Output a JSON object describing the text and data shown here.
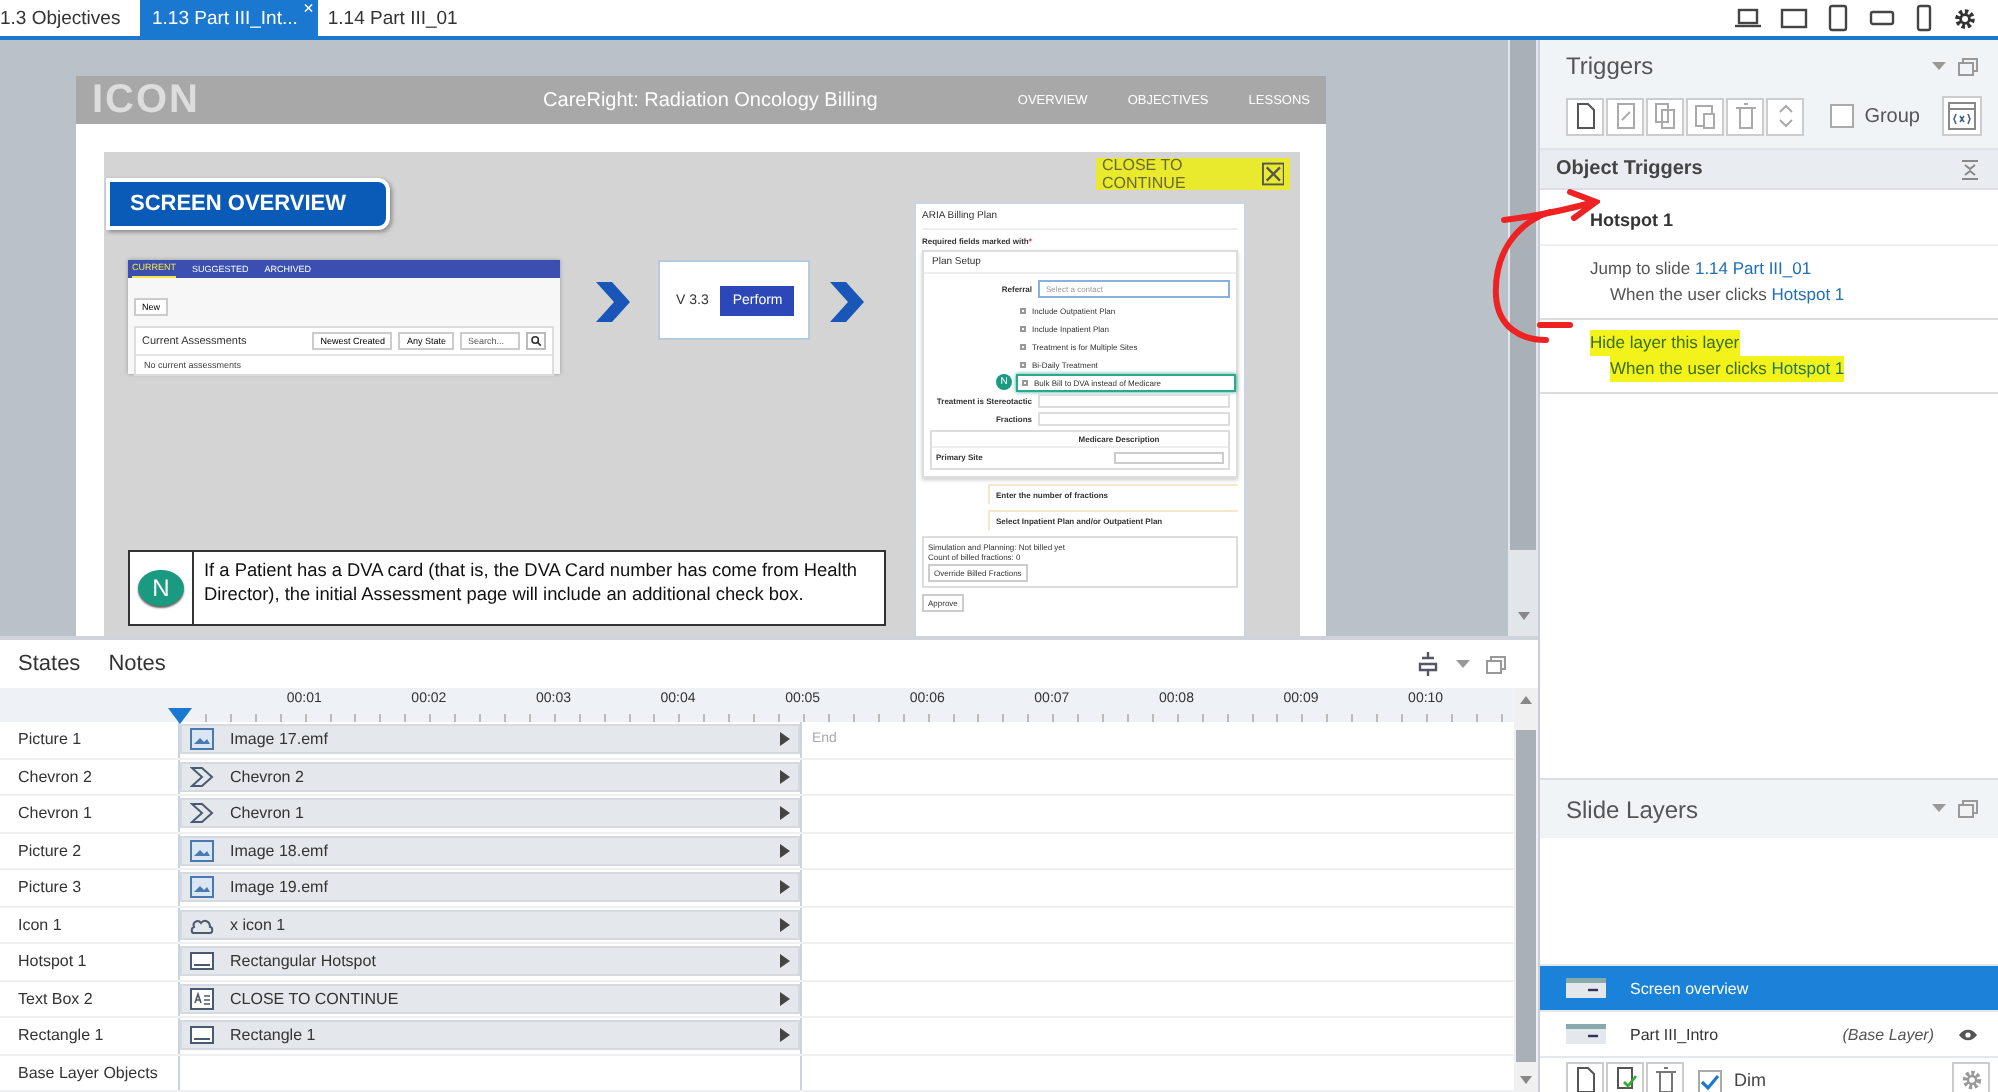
{
  "document_tabs": [
    {
      "label": "1.3 Objectives",
      "selected": false
    },
    {
      "label": "1.13 Part III_Int...",
      "selected": true,
      "close_glyph": "×"
    },
    {
      "label": "1.14 Part III_01",
      "selected": false
    }
  ],
  "slide": {
    "logo": "ICON",
    "title": "CareRight: Radiation Oncology Billing",
    "nav": [
      "OVERVIEW",
      "OBJECTIVES",
      "LESSONS"
    ],
    "heading": "SCREEN OVERVIEW",
    "close_label": "CLOSE TO CONTINUE",
    "assessments_screenshot": {
      "tabs": [
        {
          "label": "CURRENT",
          "selected": true
        },
        {
          "label": "SUGGESTED",
          "selected": false
        },
        {
          "label": "ARCHIVED",
          "selected": false
        }
      ],
      "new_button": "New",
      "card_title": "Current Assessments",
      "filters": [
        "Newest Created",
        "Any State"
      ],
      "search_placeholder": "Search...",
      "empty_text": "No current assessments"
    },
    "version": "V 3.3",
    "perform_button": "Perform",
    "billing_form": {
      "title": "ARIA Billing Plan",
      "required_note": "Required fields marked with",
      "required_mark": "*",
      "section": "Plan Setup",
      "referral_label": "Referral",
      "referral_placeholder": "Select a contact",
      "options": [
        {
          "label": "Include Outpatient Plan",
          "checked": false,
          "highlighted": false
        },
        {
          "label": "Include Inpatient Plan",
          "checked": false,
          "highlighted": false
        },
        {
          "label": "Treatment is for Multiple Sites",
          "checked": false,
          "highlighted": false
        },
        {
          "label": "Bi-Daily Treatment",
          "checked": false,
          "highlighted": false
        },
        {
          "label": "Bulk Bill to DVA instead of Medicare",
          "checked": false,
          "highlighted": true,
          "badge": "N"
        }
      ],
      "stereotactic_label": "Treatment is Stereotactic",
      "fractions_label": "Fractions",
      "medicare_heading": "Medicare Description",
      "primary_site_label": "Primary Site",
      "hints": [
        "Enter the number of fractions",
        "Select Inpatient Plan and/or Outpatient Plan"
      ],
      "summary": [
        "Simulation and Planning: Not billed yet",
        "Count of billed fractions: 0"
      ],
      "override_button": "Override Billed Fractions",
      "approve_button": "Approve"
    },
    "note": {
      "badge": "N",
      "text": "If a Patient has a DVA card (that is, the DVA Card number has come from Health Director), the initial Assessment page will include an additional check box."
    }
  },
  "timeline": {
    "tabs": [
      "States",
      "Notes"
    ],
    "ticks": [
      "00:01",
      "00:02",
      "00:03",
      "00:04",
      "00:05",
      "00:06",
      "00:07",
      "00:08",
      "00:09",
      "00:10"
    ],
    "end_label": "End",
    "rows": [
      {
        "name": "Picture 1",
        "bar_label": "Image 17.emf",
        "kind": "picture"
      },
      {
        "name": "Chevron 2",
        "bar_label": "Chevron 2",
        "kind": "chevron"
      },
      {
        "name": "Chevron 1",
        "bar_label": "Chevron 1",
        "kind": "chevron"
      },
      {
        "name": "Picture 2",
        "bar_label": "Image 18.emf",
        "kind": "picture"
      },
      {
        "name": "Picture 3",
        "bar_label": "Image 19.emf",
        "kind": "picture"
      },
      {
        "name": "Icon 1",
        "bar_label": "x icon 1",
        "kind": "icon"
      },
      {
        "name": "Hotspot 1",
        "bar_label": "Rectangular Hotspot",
        "kind": "hotspot"
      },
      {
        "name": "Text Box 2",
        "bar_label": "CLOSE TO CONTINUE",
        "kind": "textbox"
      },
      {
        "name": "Rectangle 1",
        "bar_label": "Rectangle 1",
        "kind": "rectangle"
      }
    ],
    "base_row": "Base Layer Objects"
  },
  "triggers_panel": {
    "title": "Triggers",
    "group_label": "Group",
    "group_checked": false,
    "section": "Object Triggers",
    "object": "Hotspot 1",
    "triggers": [
      {
        "action": "Jump to slide",
        "target": "1.14 Part III_01",
        "condition": "When the user clicks",
        "condition_target": "Hotspot 1",
        "highlighted": false
      },
      {
        "action": "Hide layer this layer",
        "condition": "When the user clicks",
        "condition_target": "Hotspot 1",
        "highlighted": true
      }
    ]
  },
  "slide_layers": {
    "title": "Slide Layers",
    "layers": [
      {
        "name": "Screen overview",
        "selected": true
      },
      {
        "name": "Part III_Intro",
        "note": "(Base Layer)",
        "selected": false
      }
    ],
    "dim_label": "Dim",
    "dim_checked": true
  }
}
